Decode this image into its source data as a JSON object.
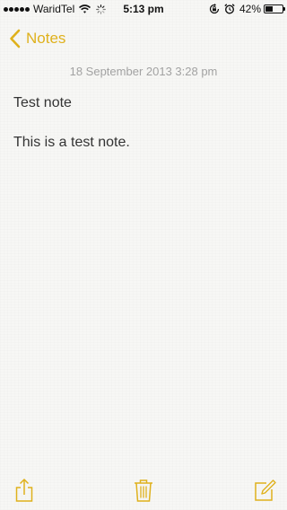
{
  "status_bar": {
    "carrier": "WaridTel",
    "time": "5:13 pm",
    "battery_percent_label": "42%",
    "battery_level": 0.42,
    "icons": [
      "signal-dots-icon",
      "wifi-icon",
      "activity-spinner-icon",
      "rotation-lock-icon",
      "alarm-icon",
      "battery-icon"
    ]
  },
  "nav": {
    "back_label": "Notes",
    "accent_color": "#dfb11c"
  },
  "note": {
    "date": "18 September 2013 3:28 pm",
    "lines": [
      "Test note",
      "",
      "This is a test note."
    ]
  },
  "toolbar": {
    "icons": [
      "share-icon",
      "trash-icon",
      "compose-icon"
    ]
  }
}
